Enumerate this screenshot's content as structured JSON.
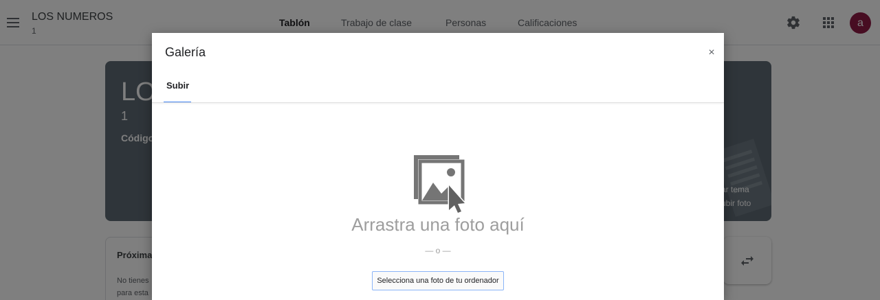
{
  "header": {
    "class_name": "LOS NUMEROS",
    "class_section": "1",
    "tabs": [
      {
        "label": "Tablón",
        "active": true
      },
      {
        "label": "Trabajo de clase",
        "active": false
      },
      {
        "label": "Personas",
        "active": false
      },
      {
        "label": "Calificaciones",
        "active": false
      }
    ],
    "icons": [
      "menu-icon",
      "gear-icon",
      "apps-grid-icon"
    ],
    "avatar_letter": "a",
    "avatar_color": "#8e1a45"
  },
  "banner": {
    "title": "LO",
    "section": "1",
    "code_label": "Código",
    "links": [
      "ar tema",
      "ubir foto"
    ],
    "color": "#5f6b74"
  },
  "upcoming": {
    "title": "Próxima",
    "text_lines": [
      "No tienes",
      "para esta"
    ]
  },
  "dialog": {
    "title": "Galería",
    "close_label": "×",
    "tab_label": "Subir",
    "drop_text": "Arrastra una foto aquí",
    "or_text": "— o —",
    "select_button": "Selecciona una foto de tu ordenador",
    "accent": "#4285f4"
  }
}
